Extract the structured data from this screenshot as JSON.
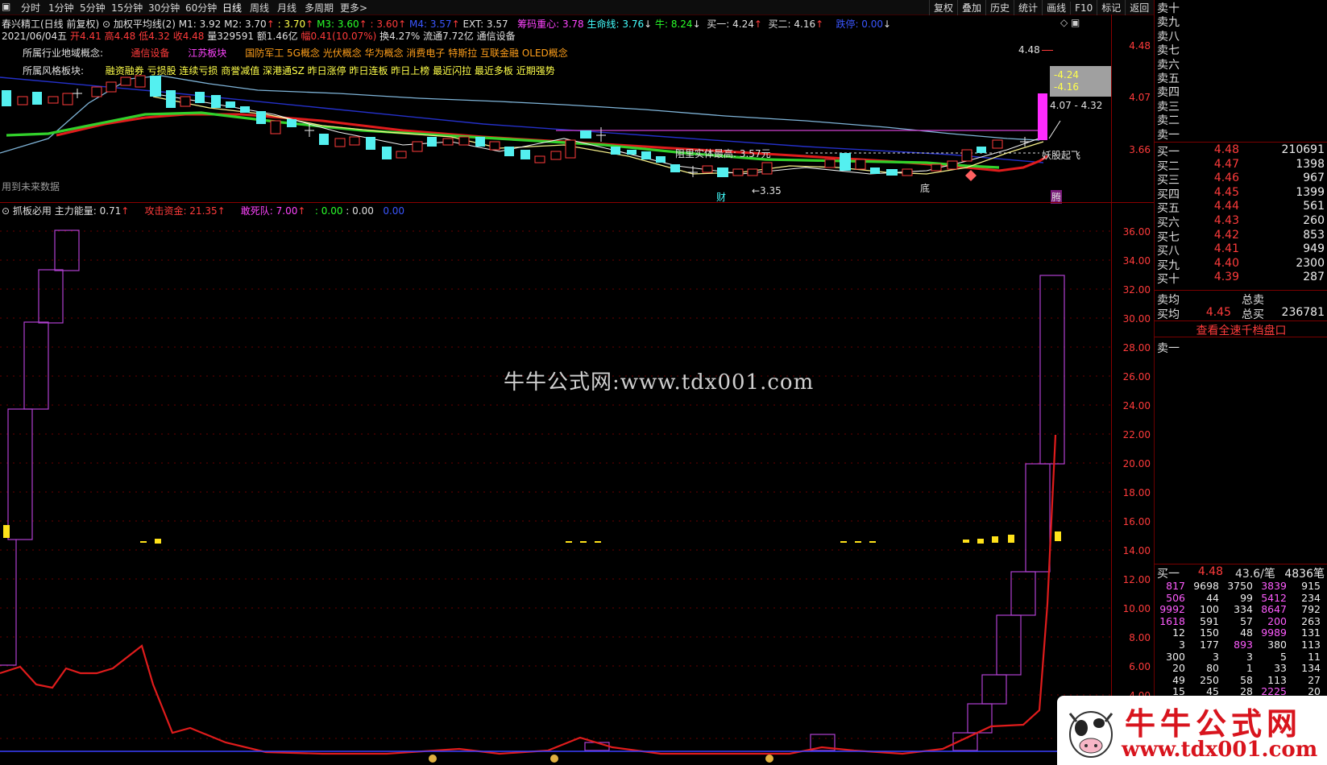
{
  "toolbar": {
    "periods": [
      "分时",
      "1分钟",
      "5分钟",
      "15分钟",
      "30分钟",
      "60分钟",
      "日线",
      "周线",
      "月线",
      "多周期",
      "更多>"
    ],
    "active_period": "日线",
    "right_buttons": [
      "复权",
      "叠加",
      "历史",
      "统计",
      "画线",
      "F10",
      "标记",
      "返回"
    ]
  },
  "chart_header": {
    "stock": "春兴精工(日线 前复权)",
    "indicator": "加权平均线(2)",
    "m1": "M1: 3.92",
    "m2": "M2: 3.70",
    "m2b": ": 3.70",
    "m3": "M3: 3.60",
    "m3b": ": 3.60",
    "m4": "M4: 3.57",
    "ext": "EXT: 3.57",
    "chip": "筹码重心: 3.78",
    "life": "生命线: 3.76",
    "bull": "牛: 8.24",
    "buy1": "买一: 4.24",
    "buy2": "买二: 4.16",
    "stop": "跌停: 0.00"
  },
  "quote_line": {
    "date": "2021/06/04五",
    "open": "开4.41",
    "high": "高4.48",
    "low": "低4.32",
    "close": "收4.48",
    "vol": "量329591",
    "amount": "额1.46亿",
    "change": "幅0.41(10.07%)",
    "turnover": "换4.27%",
    "float": "流通7.72亿",
    "sector": "通信设备"
  },
  "concepts": {
    "industry_label": "所属行业地域概念:",
    "industry": "通信设备",
    "region": "江苏板块",
    "concepts": "国防军工 5G概念 光伏概念 华为概念 消费电子 特斯拉 互联金融 OLED概念",
    "style_label": "所属风格板块:",
    "style": "融资融券 亏损股 连续亏损 商誉减值 深港通SZ 昨日涨停 昨日连板 昨日上榜 最近闪拉 最近多板 近期强势"
  },
  "upper_axis": [
    "4.48",
    "4.07",
    "3.66"
  ],
  "upper_annotations": {
    "future_note": "用到未来数据",
    "resistance": "阻里实体最高: 3.57元",
    "demon": "妖股起飞",
    "low_mark": "←3.35",
    "cai": "财",
    "di": "底",
    "teng": "腾",
    "price_top": "4.48",
    "box1": "-4.24",
    "box2": "-4.16",
    "range": "4.07 - 4.32"
  },
  "lower_header": {
    "name": "抓板必用",
    "energy": "主力能量: 0.71",
    "attack": "攻击资金: 21.35",
    "death": "敢死队: 7.00",
    "v1": ": 0.00",
    "v2": ": 0.00",
    "v3": "0.00"
  },
  "lower_axis": [
    "36.00",
    "34.00",
    "32.00",
    "30.00",
    "28.00",
    "26.00",
    "24.00",
    "22.00",
    "20.00",
    "18.00",
    "16.00",
    "14.00",
    "12.00",
    "10.00",
    "8.00",
    "6.00",
    "4.00"
  ],
  "watermark": "牛牛公式网:www.tdx001.com",
  "orderbook": {
    "sells": [
      "卖十",
      "卖九",
      "卖八",
      "卖七",
      "卖六",
      "卖五",
      "卖四",
      "卖三",
      "卖二",
      "卖一"
    ],
    "buys": [
      {
        "name": "买一",
        "price": "4.48",
        "vol": "210691"
      },
      {
        "name": "买二",
        "price": "4.47",
        "vol": "1398"
      },
      {
        "name": "买三",
        "price": "4.46",
        "vol": "967"
      },
      {
        "name": "买四",
        "price": "4.45",
        "vol": "1399"
      },
      {
        "name": "买五",
        "price": "4.44",
        "vol": "561"
      },
      {
        "name": "买六",
        "price": "4.43",
        "vol": "260"
      },
      {
        "name": "买七",
        "price": "4.42",
        "vol": "853"
      },
      {
        "name": "买八",
        "price": "4.41",
        "vol": "949"
      },
      {
        "name": "买九",
        "price": "4.40",
        "vol": "2300"
      },
      {
        "name": "买十",
        "price": "4.39",
        "vol": "287"
      }
    ],
    "sell_avg_label": "卖均",
    "sell_total_label": "总卖",
    "buy_avg_label": "买均",
    "buy_avg": "4.45",
    "buy_total_label": "总买",
    "buy_total": "236781",
    "view_all": "查看全速千档盘口",
    "sell1_queue": "卖一",
    "buy1_queue_label": "买一",
    "buy1_queue_price": "4.48",
    "buy1_queue_avg": "43.6/笔",
    "buy1_queue_count": "4836笔",
    "queue": [
      [
        "817",
        "9698",
        "3750",
        "3839",
        "915"
      ],
      [
        "506",
        "44",
        "99",
        "5412",
        "234"
      ],
      [
        "9992",
        "100",
        "334",
        "8647",
        "792"
      ],
      [
        "1618",
        "591",
        "57",
        "200",
        "263"
      ],
      [
        "12",
        "150",
        "48",
        "9989",
        "131"
      ],
      [
        "3",
        "177",
        "893",
        "380",
        "113"
      ],
      [
        "300",
        "3",
        "3",
        "5",
        "11"
      ],
      [
        "20",
        "80",
        "1",
        "33",
        "134"
      ],
      [
        "49",
        "250",
        "58",
        "113",
        "27"
      ],
      [
        "15",
        "45",
        "28",
        "2225",
        "20"
      ]
    ]
  },
  "logo": {
    "title": "牛牛公式网",
    "url": "www.tdx001.com"
  }
}
